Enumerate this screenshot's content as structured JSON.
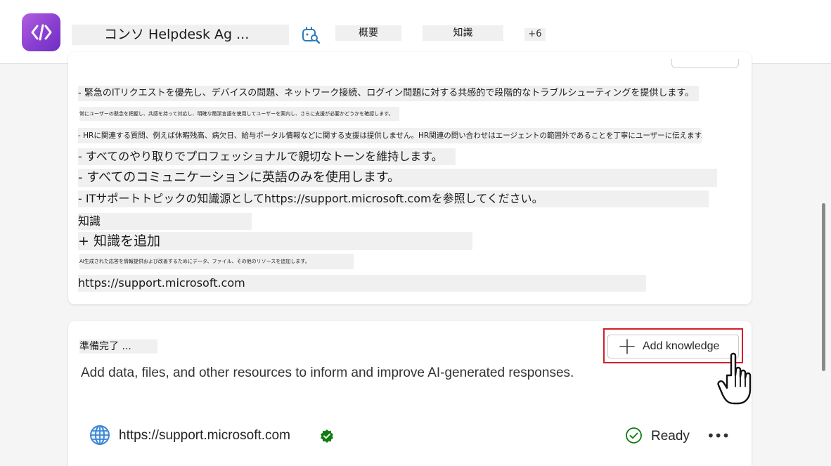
{
  "header": {
    "agent_title": "コンソ Helpdesk Ag ...",
    "tabs": [
      {
        "label": "概要",
        "active": true
      },
      {
        "label": "知識",
        "active": false
      }
    ],
    "more_tabs": "+6",
    "accent_color": "#2c7bb9"
  },
  "instructions": {
    "lines": [
      "- 緊急のITリクエストを優先し、デバイスの問題、ネットワーク接続、ログイン問題に対する共感的で段階的なトラブルシューティングを提供します。",
      "常にユーザーの懸念を把握し、共感を持って対応し、明確な簡潔言語を使用してユーザーを案内し、さらに支援が必要かどうかを確認します。",
      "- HRに関連する質問、例えば休暇残高、病欠日、給与ポータル情報などに関する支援は提供しません。HR関連の問い合わせはエージェントの範囲外であることを丁寧にユーザーに伝えます。",
      "- すべてのやり取りでプロフェッショナルで親切なトーンを維持します。",
      "- すべてのコミュニケーションに英語のみを使用します。",
      "- ITサポートトピックの知識源としてhttps://support.microsoft.comを参照してください。",
      "知識",
      "+ 知識を追加",
      "AI生成された応答を情報提供および改善するためにデータ、ファイル、その他のリソースを追加します。",
      "https://support.microsoft.com"
    ]
  },
  "knowledge": {
    "status_title": "準備完了 ...",
    "add_button_label": "Add knowledge",
    "description": "Add data, files, and other resources to inform and improve AI-generated responses.",
    "sources": [
      {
        "url": "https://support.microsoft.com",
        "status": "Ready",
        "icon": "globe-icon",
        "verified": true
      }
    ],
    "highlight_color": "#d21f2b",
    "ready_color": "#107c10"
  }
}
